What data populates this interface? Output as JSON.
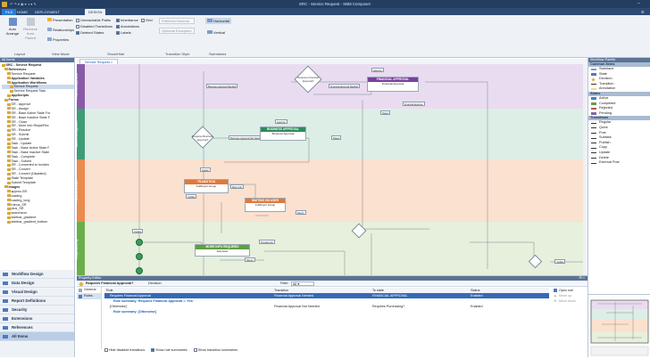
{
  "app": {
    "title": "SRC - Service Request - SBM Composer",
    "colors": {
      "chrome": "#243e62",
      "ribbon": "#eef2f7",
      "panel_header": "#5b7496"
    }
  },
  "ribbon_tabs": [
    "FILE",
    "HOME",
    "DEPLOYMENT",
    "DESIGN"
  ],
  "ribbon": {
    "layout": {
      "auto_arrange": "Auto Arrange",
      "recheck": "Recheck from Parent",
      "label": "Layout"
    },
    "view_mode": {
      "presentation": "Presentation",
      "relationships": "Relationships",
      "properties": "Properties",
      "label": "View Mode"
    },
    "show_hide": {
      "items": [
        {
          "label": "Unreachable Paths",
          "checked": false
        },
        {
          "label": "Inheritance",
          "checked": true
        },
        {
          "label": "Grid",
          "checked": false
        },
        {
          "label": "Disabled Transitions",
          "checked": false
        },
        {
          "label": "Annotations",
          "checked": true
        },
        {
          "label": "Deleted States",
          "checked": false
        },
        {
          "label": "Labels",
          "checked": true
        }
      ],
      "label": "Show/Hide"
    },
    "transition_style": {
      "preferred": "Preferred Normal",
      "optional": "Optional Exception",
      "label": "Transition Style"
    },
    "swimlanes": {
      "horizontal": "Horizontal",
      "vertical": "Vertical",
      "label": "Swimlanes"
    }
  },
  "tree": {
    "header": "All Items",
    "items": [
      "SRC - Service Request",
      "References",
      "Service Request",
      "Application Variables",
      "Application Workflows",
      "Service Request",
      "Service Request Task",
      "AppScripts",
      "Forms",
      "SR - Approve",
      "SR - Assign",
      "SR - Base Active State For",
      "SR - Base Inactive State F",
      "SR - Close",
      "SR - More Info Reqst/Rec",
      "SR - Resolve",
      "SR - Submit",
      "SR - Update",
      "Task - Update",
      "Task - Base Active State F",
      "Task - Base Inactive State",
      "Task - Complete",
      "Task - Submit",
      "SR - Converted to Inciden",
      "SR - Convert",
      "SR - Convert (Disabled)",
      "State Template",
      "Submit Template",
      "Images",
      "approv-SR",
      "loading",
      "loading_long",
      "minus_SR",
      "plus_SR",
      "searchicon",
      "sidebar_gradient",
      "sidebar_gradient_bottom"
    ]
  },
  "nav": [
    "Workflow Design",
    "Data Design",
    "Visual Design",
    "Report Definitions",
    "Security",
    "Extensions",
    "References",
    "All Items"
  ],
  "canvas": {
    "doc_tab": "Service Request",
    "lanes": [
      "Financial Approval",
      "Business Approver",
      "Fulfilment Team",
      "Requested By"
    ],
    "states": {
      "financial": {
        "title": "FINANCIAL APPROVAL",
        "sub": "Financial Approval"
      },
      "business": {
        "title": "BUSINESS APPROVAL",
        "sub": "Business Approval"
      },
      "transition": {
        "title": "TRANSITION",
        "sub": "Fulfilment Group"
      },
      "waiting": {
        "title": "WAITING ON USER",
        "sub": "Fulfilment Group"
      },
      "more_info": {
        "title": "MORE INFO REQUIRED",
        "sub": "Submitter"
      }
    },
    "labels": {
      "business_needed": "Business Approval Needed",
      "financial_needed": "Financial Approval Needed",
      "business_not_needed": "Business Approval Not Needed",
      "reject": "Reject",
      "approve": "Approve",
      "assign": "Assign",
      "more_info": "More Info",
      "return": "Return",
      "financial_approve": "Financial Approve",
      "business_approve": "Business Approve",
      "provide_info": "Provide Info",
      "update": "Update",
      "decision_fin": "Requires Financial Approval?",
      "decision_bus": "Requires Business Approval?",
      "update_label": "Update"
    }
  },
  "props": {
    "header": "Property Editor",
    "title": "Requires Financial Approval?",
    "type": "Decision",
    "filter_label": "Filter:",
    "filter_value": "All",
    "side_tabs": [
      "General",
      "Rules"
    ],
    "columns": [
      "Rule",
      "Transition",
      "To state",
      "Status"
    ],
    "rows": [
      {
        "rule": "Requires Financial Approval",
        "transition": "Financial Approval Needed",
        "to": "FINANCIAL APPROVAL",
        "status": "Enabled"
      },
      {
        "rule": "Rule summary: Requires Financial Approval = 'Yes'",
        "transition": "",
        "to": "",
        "status": ""
      },
      {
        "rule": "[Otherwise]",
        "transition": "Financial Approval Not Needed",
        "to": "Requires Purchasing?",
        "status": "Enabled"
      },
      {
        "rule": "Rule summary: [Otherwise]",
        "transition": "",
        "to": "",
        "status": ""
      }
    ],
    "actions": [
      "Open rule",
      "Move up",
      "Move down"
    ],
    "footer": [
      {
        "label": "Hide disabled transitions",
        "checked": false
      },
      {
        "label": "Show rule summaries",
        "checked": true
      },
      {
        "label": "Show transition summaries",
        "checked": false
      }
    ]
  },
  "toolbox": {
    "header": "Workflow Palette",
    "sections": [
      {
        "name": "Common Items",
        "items": [
          "Swimlane",
          "State",
          "Decision",
          "Transition",
          "Annotation"
        ]
      },
      {
        "name": "States",
        "items": [
          "Active",
          "Completed",
          "Rejected",
          "Pending"
        ]
      },
      {
        "name": "Transitions",
        "items": [
          "Regular",
          "Quick",
          "Post",
          "Subtask",
          "Publish",
          "Copy",
          "Update",
          "Delete",
          "External Post"
        ]
      }
    ]
  }
}
